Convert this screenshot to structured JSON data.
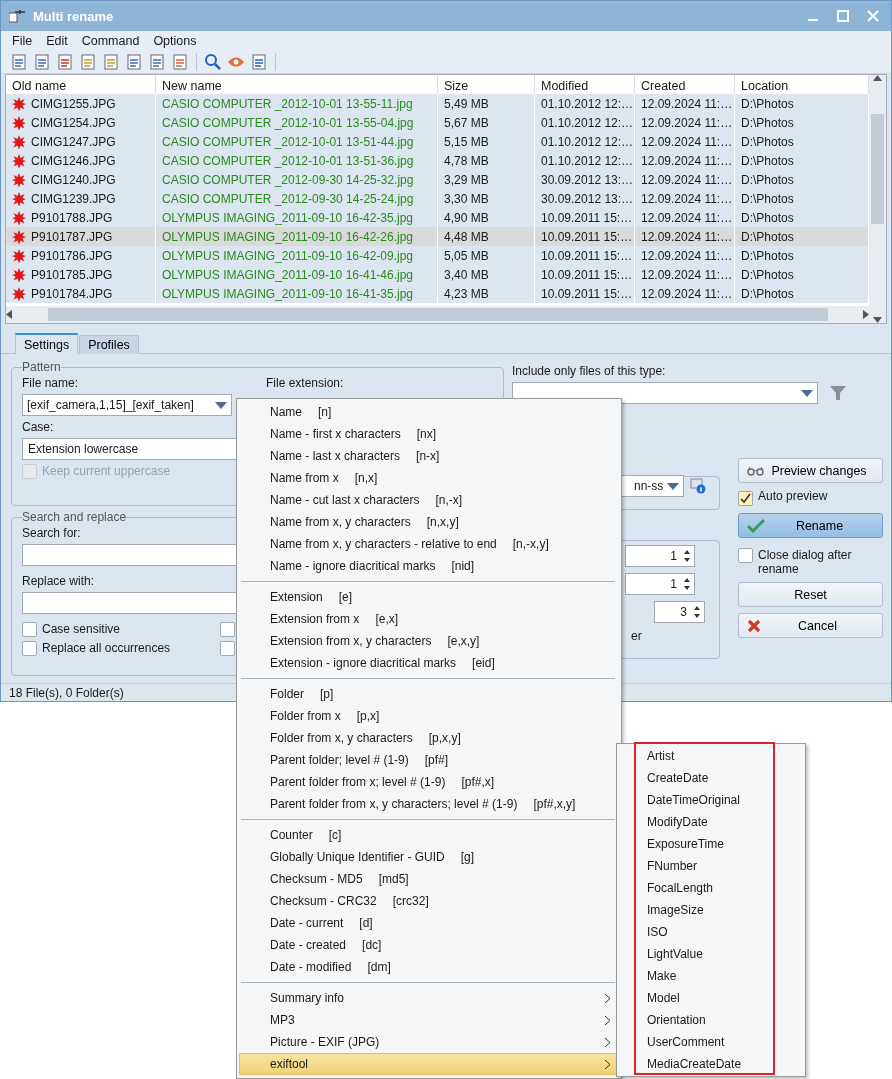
{
  "window": {
    "title": "Multi rename"
  },
  "menu_bar": [
    "File",
    "Edit",
    "Command",
    "Options"
  ],
  "table": {
    "columns": [
      "Old name",
      "New name",
      "Size",
      "Modified",
      "Created",
      "Location"
    ],
    "rows": [
      {
        "old_name": "CIMG1255.JPG",
        "new_name": "CASIO COMPUTER _2012-10-01 13-55-11.jpg",
        "size": "5,49 MB",
        "modified": "01.10.2012 12:…",
        "created": "12.09.2024 11:…",
        "location": "D:\\Photos",
        "selected": false
      },
      {
        "old_name": "CIMG1254.JPG",
        "new_name": "CASIO COMPUTER _2012-10-01 13-55-04.jpg",
        "size": "5,67 MB",
        "modified": "01.10.2012 12:…",
        "created": "12.09.2024 11:…",
        "location": "D:\\Photos",
        "selected": false
      },
      {
        "old_name": "CIMG1247.JPG",
        "new_name": "CASIO COMPUTER _2012-10-01 13-51-44.jpg",
        "size": "5,15 MB",
        "modified": "01.10.2012 12:…",
        "created": "12.09.2024 11:…",
        "location": "D:\\Photos",
        "selected": false
      },
      {
        "old_name": "CIMG1246.JPG",
        "new_name": "CASIO COMPUTER _2012-10-01 13-51-36.jpg",
        "size": "4,78 MB",
        "modified": "01.10.2012 12:…",
        "created": "12.09.2024 11:…",
        "location": "D:\\Photos",
        "selected": false
      },
      {
        "old_name": "CIMG1240.JPG",
        "new_name": "CASIO COMPUTER _2012-09-30 14-25-32.jpg",
        "size": "3,29 MB",
        "modified": "30.09.2012 13:…",
        "created": "12.09.2024 11:…",
        "location": "D:\\Photos",
        "selected": false
      },
      {
        "old_name": "CIMG1239.JPG",
        "new_name": "CASIO COMPUTER _2012-09-30 14-25-24.jpg",
        "size": "3,30 MB",
        "modified": "30.09.2012 13:…",
        "created": "12.09.2024 11:…",
        "location": "D:\\Photos",
        "selected": false
      },
      {
        "old_name": "P9101788.JPG",
        "new_name": "OLYMPUS IMAGING_2011-09-10 16-42-35.jpg",
        "size": "4,90 MB",
        "modified": "10.09.2011 15:…",
        "created": "12.09.2024 11:…",
        "location": "D:\\Photos",
        "selected": false
      },
      {
        "old_name": "P9101787.JPG",
        "new_name": "OLYMPUS IMAGING_2011-09-10 16-42-26.jpg",
        "size": "4,48 MB",
        "modified": "10.09.2011 15:…",
        "created": "12.09.2024 11:…",
        "location": "D:\\Photos",
        "selected": true
      },
      {
        "old_name": "P9101786.JPG",
        "new_name": "OLYMPUS IMAGING_2011-09-10 16-42-09.jpg",
        "size": "5,05 MB",
        "modified": "10.09.2011 15:…",
        "created": "12.09.2024 11:…",
        "location": "D:\\Photos",
        "selected": false
      },
      {
        "old_name": "P9101785.JPG",
        "new_name": "OLYMPUS IMAGING_2011-09-10 16-41-46.jpg",
        "size": "3,40 MB",
        "modified": "10.09.2011 15:…",
        "created": "12.09.2024 11:…",
        "location": "D:\\Photos",
        "selected": false
      },
      {
        "old_name": "P9101784.JPG",
        "new_name": "OLYMPUS IMAGING_2011-09-10 16-41-35.jpg",
        "size": "4,23 MB",
        "modified": "10.09.2011 15:…",
        "created": "12.09.2024 11:…",
        "location": "D:\\Photos",
        "selected": false
      }
    ]
  },
  "tabs": [
    {
      "label": "Settings",
      "selected": true
    },
    {
      "label": "Profiles",
      "selected": false
    }
  ],
  "pattern": {
    "title": "Pattern",
    "file_name_label": "File name:",
    "file_name_value": "[exif_camera,1,15]_[exif_taken]",
    "file_extension_label": "File extension:",
    "case_label": "Case:",
    "case_value": "Extension lowercase",
    "keep_uppercase": {
      "label": "Keep current uppercase",
      "checked": false,
      "disabled": true
    }
  },
  "search_replace": {
    "title": "Search and replace",
    "search_label": "Search for:",
    "replace_label": "Replace with:",
    "options": [
      {
        "label": "Case sensitive",
        "checked": false
      },
      {
        "label": "Replace all occurrences",
        "checked": false
      }
    ],
    "options_column_2": [
      {
        "checked": false
      },
      {
        "checked": false
      }
    ]
  },
  "filter": {
    "label": "Include only files of this type:"
  },
  "date_format": {
    "value": "nn-ss"
  },
  "counter": {
    "spinners": [
      "1",
      "1",
      "3"
    ],
    "text": "er"
  },
  "actions": {
    "preview": "Preview changes",
    "auto_preview": {
      "label": "Auto preview",
      "checked": true
    },
    "rename": "Rename",
    "close_after": {
      "label": "Close dialog after rename",
      "checked": false
    },
    "reset": "Reset",
    "cancel": "Cancel"
  },
  "status_bar": "18 File(s), 0 Folder(s)",
  "context_menu": {
    "groups": [
      [
        {
          "kind": "placeholder",
          "label": "Name",
          "shortcut": "[n]",
          "selected": false
        },
        {
          "kind": "placeholder",
          "label": "Name - first x characters",
          "shortcut": "[nx]",
          "selected": false
        },
        {
          "kind": "placeholder",
          "label": "Name - last x characters",
          "shortcut": "[n-x]",
          "selected": false
        },
        {
          "kind": "placeholder",
          "label": "Name from x",
          "shortcut": "[n,x]",
          "selected": false
        },
        {
          "kind": "placeholder",
          "label": "Name - cut last x characters",
          "shortcut": "[n,-x]",
          "selected": false
        },
        {
          "kind": "placeholder",
          "label": "Name from x, y characters",
          "shortcut": "[n,x,y]",
          "selected": false
        },
        {
          "kind": "placeholder",
          "label": "Name from x, y characters - relative to end",
          "shortcut": "[n,-x,y]",
          "selected": false
        },
        {
          "kind": "placeholder",
          "label": "Name - ignore diacritical marks",
          "shortcut": "[nid]",
          "selected": false
        }
      ],
      [
        {
          "kind": "placeholder",
          "label": "Extension",
          "shortcut": "[e]",
          "selected": false
        },
        {
          "kind": "placeholder",
          "label": "Extension from x",
          "shortcut": "[e,x]",
          "selected": false
        },
        {
          "kind": "placeholder",
          "label": "Extension from x, y characters",
          "shortcut": "[e,x,y]",
          "selected": false
        },
        {
          "kind": "placeholder",
          "label": "Extension - ignore diacritical marks",
          "shortcut": "[eid]",
          "selected": false
        }
      ],
      [
        {
          "kind": "placeholder",
          "label": "Folder",
          "shortcut": "[p]",
          "selected": false
        },
        {
          "kind": "placeholder",
          "label": "Folder from x",
          "shortcut": "[p,x]",
          "selected": false
        },
        {
          "kind": "placeholder",
          "label": "Folder from x, y characters",
          "shortcut": "[p,x,y]",
          "selected": false
        },
        {
          "kind": "placeholder",
          "label": "Parent folder; level # (1-9)",
          "shortcut": "[pf#]",
          "selected": false
        },
        {
          "kind": "placeholder",
          "label": "Parent folder from x; level # (1-9)",
          "shortcut": "[pf#,x]",
          "selected": false
        },
        {
          "kind": "placeholder",
          "label": "Parent folder from x, y characters; level # (1-9)",
          "shortcut": "[pf#,x,y]",
          "selected": false
        }
      ],
      [
        {
          "kind": "placeholder",
          "label": "Counter",
          "shortcut": "[c]",
          "selected": false
        },
        {
          "kind": "placeholder",
          "label": "Globally Unique Identifier - GUID",
          "shortcut": "[g]",
          "selected": false
        },
        {
          "kind": "placeholder",
          "label": "Checksum - MD5",
          "shortcut": "[md5]",
          "selected": false
        },
        {
          "kind": "placeholder",
          "label": "Checksum - CRC32",
          "shortcut": "[crc32]",
          "selected": false
        },
        {
          "kind": "placeholder",
          "label": "Date - current",
          "shortcut": "[d]",
          "selected": false
        },
        {
          "kind": "placeholder",
          "label": "Date - created",
          "shortcut": "[dc]",
          "selected": false
        },
        {
          "kind": "placeholder",
          "label": "Date - modified",
          "shortcut": "[dm]",
          "selected": false
        }
      ],
      [
        {
          "kind": "submenu",
          "label": "Summary info",
          "selected": false
        },
        {
          "kind": "submenu",
          "label": "MP3",
          "selected": false
        },
        {
          "kind": "submenu",
          "label": "Picture - EXIF (JPG)",
          "selected": false
        },
        {
          "kind": "submenu",
          "label": "exiftool",
          "selected": true
        }
      ]
    ]
  },
  "submenu": {
    "items": [
      "Artist",
      "CreateDate",
      "DateTimeOriginal",
      "ModifyDate",
      "ExposureTime",
      "FNumber",
      "FocalLength",
      "ImageSize",
      "ISO",
      "LightValue",
      "Make",
      "Model",
      "Orientation",
      "UserComment",
      "MediaCreateDate"
    ]
  }
}
